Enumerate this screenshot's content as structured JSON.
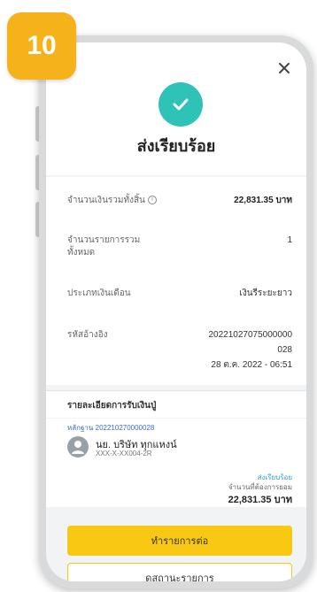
{
  "step": {
    "number": "10"
  },
  "header": {
    "title": "ส่งเรียบร้อย"
  },
  "summary": {
    "total_amount_label": "จำนวนเงินรวมทั้งสิ้น",
    "total_amount": "22,831.35 บาท",
    "total_items_label": "จำนวนรายการรวมทั้งหมด",
    "total_items": "1",
    "transfer_type_label": "ประเภทเงินเดือน",
    "transfer_type": "เงินรีระยะยาว",
    "reference_label": "รหัสอ้างอิง",
    "reference_line1": "20221027075000000",
    "reference_line2": "028",
    "datetime": "28 ต.ค. 2022 - 06:51"
  },
  "recipient": {
    "section_title": "รายละเอียดการรับเงินปู่",
    "reference": "หลักฐาน 202210270000028",
    "name": "นย. บริษัท ทุกแหงน์",
    "account": "XXX-X-XX004-2R",
    "status": "ส่งเรียบร้อย",
    "amount_label": "จำนวนที่ต้องการยอม",
    "amount": "22,831.35 บาท"
  },
  "actions": {
    "primary_label": "ทำรายการต่อ",
    "secondary_label": "ดูสถานะรายการ"
  },
  "colors": {
    "accent": "#f8c813",
    "success": "#2fc2b6",
    "badge": "#f5b21b"
  }
}
